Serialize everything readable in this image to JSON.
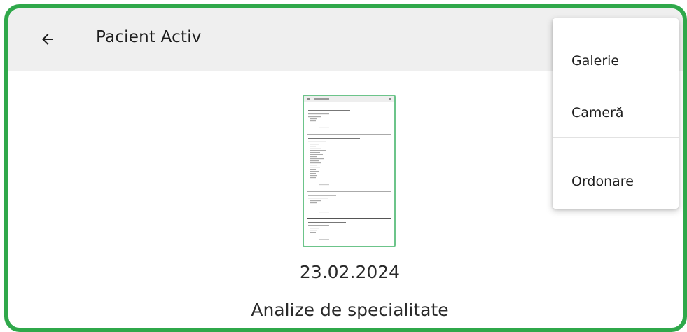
{
  "appbar": {
    "title": "Pacient Activ",
    "back_icon": "arrow-left-icon"
  },
  "document": {
    "date": "23.02.2024",
    "caption": "Analize de specialitate"
  },
  "menu": {
    "items": [
      {
        "label": "Galerie"
      },
      {
        "label": "Cameră"
      },
      {
        "label": "Ordonare"
      }
    ]
  },
  "colors": {
    "frame_border": "#2fa84a",
    "appbar_bg": "#efefef",
    "thumbnail_border": "#6cc48a"
  }
}
